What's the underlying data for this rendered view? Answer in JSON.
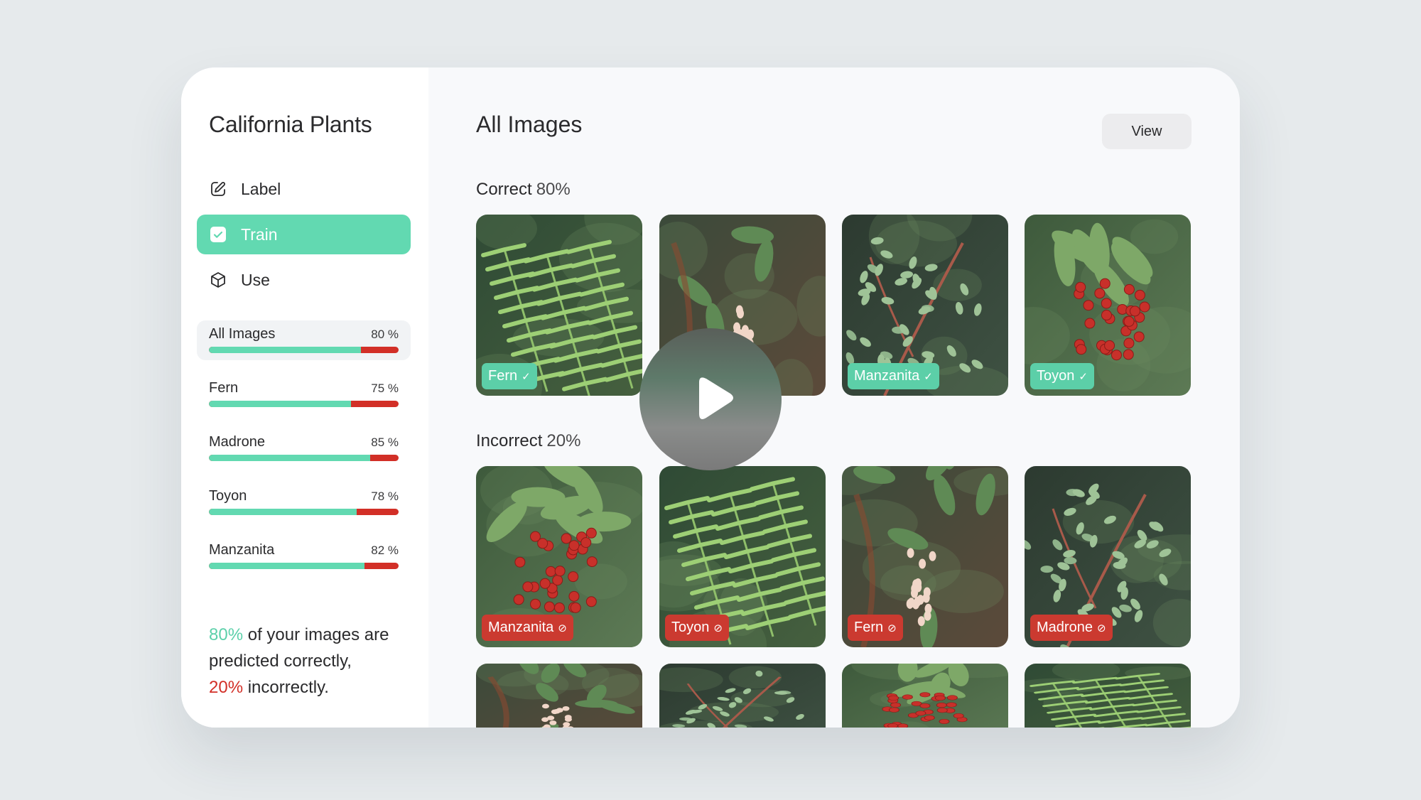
{
  "sidebar": {
    "title": "California Plants",
    "nav": [
      {
        "label": "Label",
        "icon": "edit-icon",
        "active": false
      },
      {
        "label": "Train",
        "icon": "checkbox-icon",
        "active": true
      },
      {
        "label": "Use",
        "icon": "cube-icon",
        "active": false
      }
    ],
    "stats": [
      {
        "name": "All Images",
        "pct_label": "80 %",
        "correct_fraction": 0.8,
        "active": true
      },
      {
        "name": "Fern",
        "pct_label": "75 %",
        "correct_fraction": 0.75,
        "active": false
      },
      {
        "name": "Madrone",
        "pct_label": "85 %",
        "correct_fraction": 0.85,
        "active": false
      },
      {
        "name": "Toyon",
        "pct_label": "78 %",
        "correct_fraction": 0.78,
        "active": false
      },
      {
        "name": "Manzanita",
        "pct_label": "82 %",
        "correct_fraction": 0.82,
        "active": false
      }
    ],
    "summary": {
      "correct_pct": "80%",
      "text1": " of your images are predicted correctly,",
      "incorrect_pct": "20%",
      "text2": " incorrectly."
    }
  },
  "main": {
    "title": "All Images",
    "view_button": "View",
    "correct_section": {
      "label": "Correct",
      "pct": "80%"
    },
    "incorrect_section": {
      "label": "Incorrect",
      "pct": "20%"
    },
    "correct_images": [
      {
        "subject": "fern",
        "label": "Fern",
        "status": "correct"
      },
      {
        "subject": "madrone",
        "label": "",
        "status": "correct"
      },
      {
        "subject": "manzanita",
        "label": "Manzanita",
        "status": "correct"
      },
      {
        "subject": "toyon",
        "label": "Toyon",
        "status": "correct"
      }
    ],
    "incorrect_images": [
      {
        "subject": "toyon",
        "label": "Manzanita",
        "status": "incorrect"
      },
      {
        "subject": "fern",
        "label": "Toyon",
        "status": "incorrect"
      },
      {
        "subject": "madrone",
        "label": "Fern",
        "status": "incorrect"
      },
      {
        "subject": "manzanita",
        "label": "Madrone",
        "status": "incorrect"
      }
    ],
    "more_images": [
      {
        "subject": "madrone"
      },
      {
        "subject": "manzanita"
      },
      {
        "subject": "toyon"
      },
      {
        "subject": "fern"
      }
    ]
  },
  "colors": {
    "accent_green": "#62d9b1",
    "error_red": "#d22f27"
  },
  "icons": {
    "check": "✓",
    "blocked": "⊘"
  }
}
